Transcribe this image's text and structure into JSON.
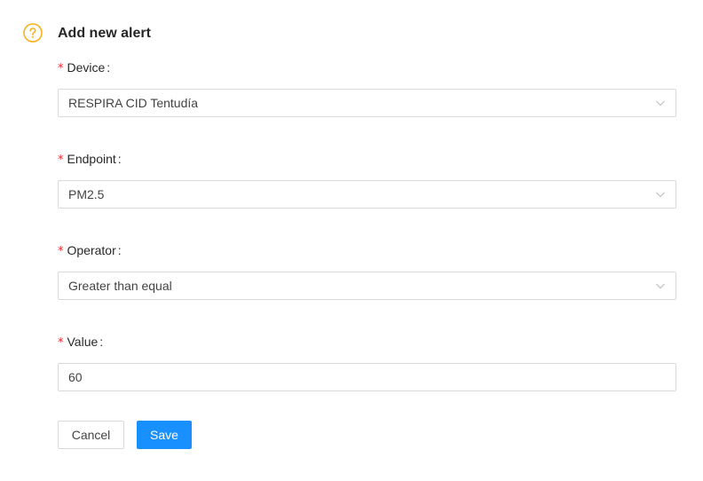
{
  "dialog": {
    "title": "Add new alert",
    "icon": "question-circle-icon",
    "icon_color": "#faad14"
  },
  "form": {
    "required_mark": "*",
    "colon": ":",
    "device": {
      "label": "Device",
      "value": "RESPIRA CID Tentudía"
    },
    "endpoint": {
      "label": "Endpoint",
      "value": "PM2.5"
    },
    "operator": {
      "label": "Operator",
      "value": "Greater than equal"
    },
    "value": {
      "label": "Value",
      "value": "60"
    }
  },
  "actions": {
    "cancel_label": "Cancel",
    "save_label": "Save",
    "primary_color": "#1890ff"
  }
}
